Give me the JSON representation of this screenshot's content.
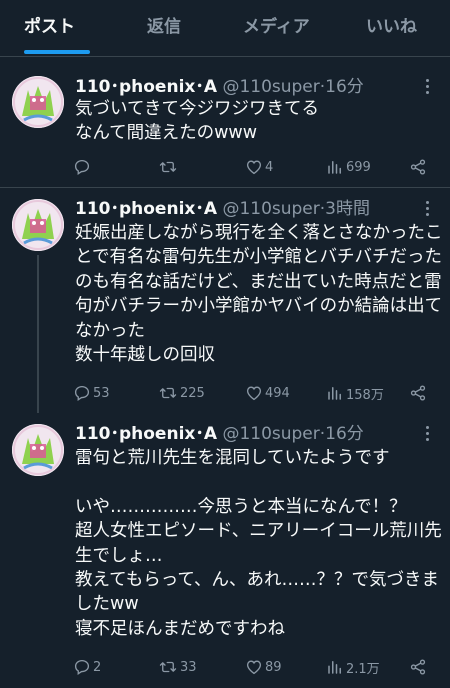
{
  "tabs": [
    "ポスト",
    "返信",
    "メディア",
    "いいね"
  ],
  "active_tab": 0,
  "colors": {
    "background": "#15202b",
    "accent": "#1d9bf0",
    "muted": "#8b98a5",
    "divider": "#38444d"
  },
  "tweets": [
    {
      "name": "110･phoenix･A",
      "handle": "@110super",
      "time": "16分",
      "text": "気づいてきて今ジワジワきてる\nなんて間違えたのwww",
      "stats": {
        "replies": "",
        "reposts": "",
        "likes": "4",
        "views": "699"
      }
    },
    {
      "name": "110･phoenix･A",
      "handle": "@110super",
      "time": "3時間",
      "text": "妊娠出産しながら現行を全く落とさなかったことで有名な雷句先生が小学館とバチバチだったのも有名な話だけど、まだ出ていた時点だと雷句がバチラーか小学館かヤバイのか結論は出てなかった\n数十年越しの回収",
      "stats": {
        "replies": "53",
        "reposts": "225",
        "likes": "494",
        "views": "158万"
      }
    },
    {
      "name": "110･phoenix･A",
      "handle": "@110super",
      "time": "16分",
      "text": "雷句と荒川先生を混同していたようです\n\nいや……………今思うと本当になんで！？\n超人女性エピソード、ニアリーイコール荒川先生でしょ…\n教えてもらって、ん、あれ……？？で気づきましたww\n寝不足ほんまだめですわね",
      "stats": {
        "replies": "2",
        "reposts": "33",
        "likes": "89",
        "views": "2.1万"
      }
    }
  ]
}
